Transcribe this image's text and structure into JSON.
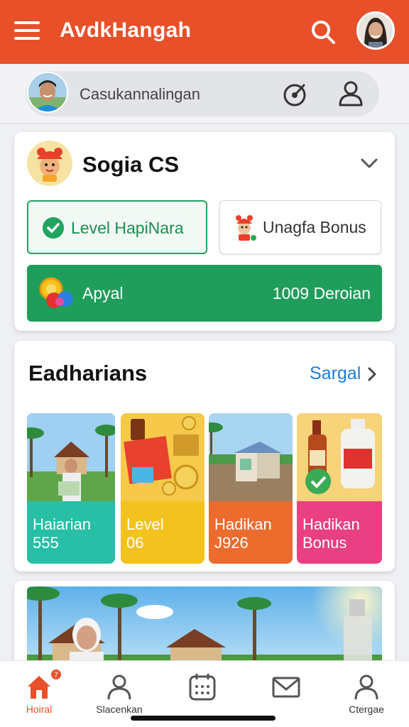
{
  "header": {
    "app_title": "AvdkHangah",
    "brand_color": "#e8502a",
    "menu_icon": "hamburger-menu-icon",
    "search_icon": "search-icon",
    "avatar_icon": "user-avatar"
  },
  "account": {
    "name": "Casukannalingan",
    "target_icon": "target-icon",
    "profile_icon": "user-outline-icon"
  },
  "promo_card": {
    "title": "Sogia CS",
    "level_button": "Level HapiNara",
    "bonus_button": "Unagfa Bonus",
    "apply_label": "Apyal",
    "apply_value": "1009 Deroian",
    "accent_green": "#1f9e5b"
  },
  "section": {
    "title": "Eadharians",
    "see_all": "Sargal",
    "tiles": [
      {
        "line1": "Haiarian",
        "line2": "555",
        "color": "#27bfa6"
      },
      {
        "line1": "Level",
        "line2": "06",
        "color": "#f4c21e"
      },
      {
        "line1": "Hadikan",
        "line2": "J926",
        "color": "#ec6c2e"
      },
      {
        "line1": "Hadikan",
        "line2": "Bonus",
        "color": "#ea3f82"
      }
    ]
  },
  "bottom_nav": {
    "items": [
      {
        "label": "Hoiral",
        "icon": "home-icon",
        "badge": "7"
      },
      {
        "label": "Slacenkan",
        "icon": "person-icon"
      },
      {
        "label": "",
        "icon": "calendar-icon"
      },
      {
        "label": "",
        "icon": "mail-icon"
      },
      {
        "label": "Ctergae",
        "icon": "profile-icon"
      }
    ]
  }
}
